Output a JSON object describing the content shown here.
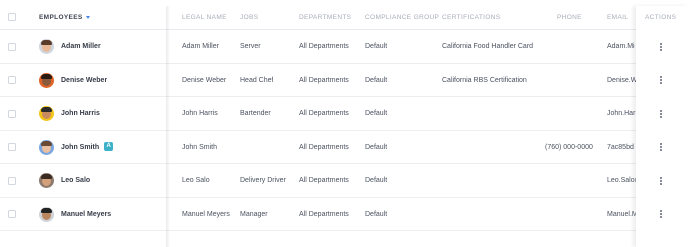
{
  "columns": {
    "employees": "Employees",
    "legal_name": "Legal Name",
    "jobs": "Jobs",
    "departments": "Departments",
    "compliance_group": "Compliance Group",
    "certifications": "Certifications",
    "phone": "Phone",
    "email": "Email",
    "actions": "Actions"
  },
  "sort_indicator": {
    "icon": "sort-down-icon",
    "color": "#4a84e6"
  },
  "employees": [
    {
      "name": "Adam Miller",
      "legal_name": "Adam Miller",
      "job": "Server",
      "department": "All Departments",
      "compliance_group": "Default",
      "certification": "California Food Handler Card",
      "phone": "",
      "email": "Adam.Mi",
      "avatar": {
        "bg": "#cfd6df",
        "skin": "#e8b998",
        "hair": "#5a3c2a"
      },
      "badge": ""
    },
    {
      "name": "Denise Weber",
      "legal_name": "Denise Weber",
      "job": "Head Chef",
      "department": "All Departments",
      "compliance_group": "Default",
      "certification": "California RBS Certification",
      "phone": "",
      "email": "Denise.W",
      "avatar": {
        "bg": "#e0642a",
        "skin": "#8a5a3c",
        "hair": "#2a1a12"
      },
      "badge": ""
    },
    {
      "name": "John Harris",
      "legal_name": "John Harris",
      "job": "Bartender",
      "department": "All Departments",
      "compliance_group": "Default",
      "certification": "",
      "phone": "",
      "email": "John.Har",
      "avatar": {
        "bg": "#f2c418",
        "skin": "#c98a60",
        "hair": "#2b2b2b"
      },
      "badge": ""
    },
    {
      "name": "John Smith",
      "legal_name": "John Smith",
      "job": "",
      "department": "All Departments",
      "compliance_group": "Default",
      "certification": "",
      "phone": "(760) 000-0000",
      "email": "7ac85bd",
      "avatar": {
        "bg": "#7aa6e0",
        "skin": "#e9bf9f",
        "hair": "#6b4a35"
      },
      "badge": "A"
    },
    {
      "name": "Leo Salo",
      "legal_name": "Leo Salo",
      "job": "Delivery Driver",
      "department": "All Departments",
      "compliance_group": "Default",
      "certification": "",
      "phone": "",
      "email": "Leo.Salo@",
      "avatar": {
        "bg": "#8c7a6e",
        "skin": "#d3a07a",
        "hair": "#3a2a22"
      },
      "badge": ""
    },
    {
      "name": "Manuel Meyers",
      "legal_name": "Manuel Meyers",
      "job": "Manager",
      "department": "All Departments",
      "compliance_group": "Default",
      "certification": "",
      "phone": "",
      "email": "Manuel.M",
      "avatar": {
        "bg": "#cfd3d8",
        "skin": "#b98660",
        "hair": "#222222"
      },
      "badge": ""
    }
  ]
}
